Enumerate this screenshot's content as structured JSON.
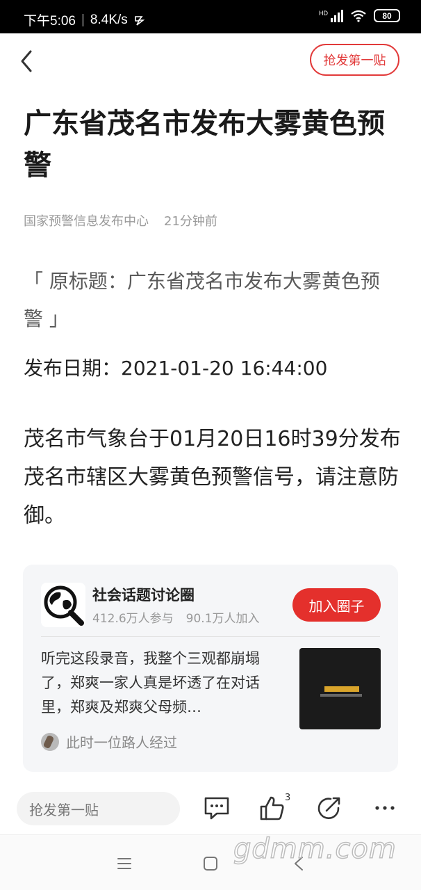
{
  "status_bar": {
    "time": "下午5:06",
    "speed": "8.4K/s",
    "network_badge": "HD",
    "battery": "80"
  },
  "header": {
    "grab_first_post_label": "抢发第一贴"
  },
  "article": {
    "title": "广东省茂名市发布大雾黄色预警",
    "source": "国家预警信息发布中心",
    "time_ago": "21分钟前",
    "original_title": "「 原标题：广东省茂名市发布大雾黄色预警 」",
    "publish_date": "发布日期：2021-01-20 16:44:00",
    "body": "茂名市气象台于01月20日16时39分发布茂名市辖区大雾黄色预警信号，请注意防御。"
  },
  "circle_card": {
    "name": "社会话题讨论圈",
    "participants": "412.6万人参与",
    "joined": "90.1万人加入",
    "join_label": "加入圈子",
    "post_text": "听完这段录音，我整个三观都崩塌了，郑爽一家人真是坏透了在对话里，郑爽及郑爽父母频…",
    "passer_text": "此时一位路人经过"
  },
  "bottom_bar": {
    "comment_placeholder": "抢发第一贴",
    "like_count": "3"
  },
  "watermark": "gdmm.com",
  "colors": {
    "accent": "#e4302c",
    "outline_red": "#e23a3a"
  }
}
